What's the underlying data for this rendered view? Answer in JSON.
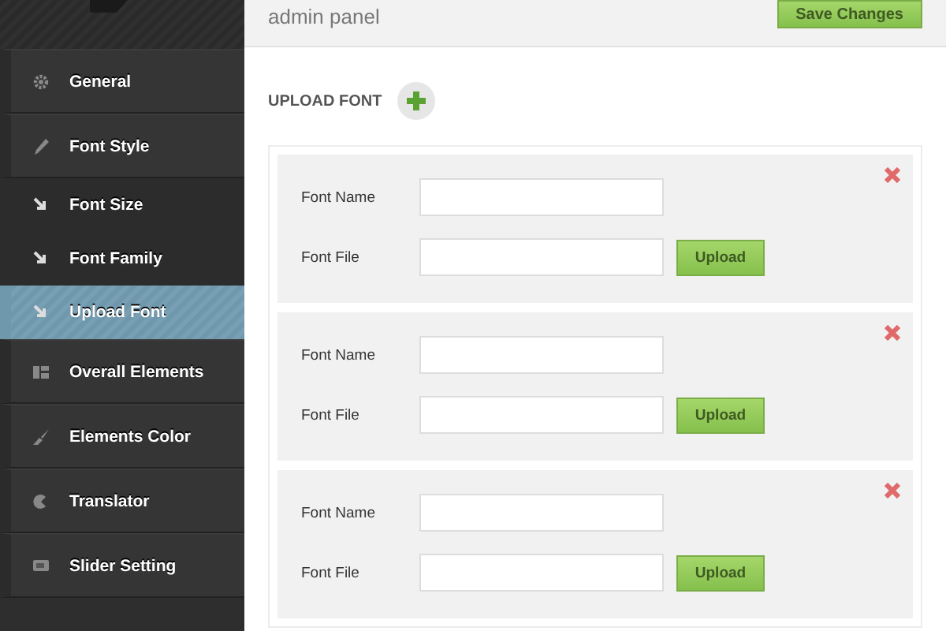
{
  "header": {
    "title": "admin panel",
    "save_button": "Save Changes"
  },
  "sidebar": {
    "items": [
      {
        "label": "General",
        "selected": false
      },
      {
        "label": "Font Style",
        "selected": false,
        "children": [
          {
            "label": "Font Size",
            "selected": false
          },
          {
            "label": "Font Family",
            "selected": false
          },
          {
            "label": "Upload Font",
            "selected": true
          }
        ]
      },
      {
        "label": "Overall Elements",
        "selected": false
      },
      {
        "label": "Elements Color",
        "selected": false
      },
      {
        "label": "Translator",
        "selected": false
      },
      {
        "label": "Slider Setting",
        "selected": false
      }
    ]
  },
  "section": {
    "title": "UPLOAD FONT",
    "entries": [
      {
        "name_label": "Font Name",
        "file_label": "Font File",
        "upload_button": "Upload"
      },
      {
        "name_label": "Font Name",
        "file_label": "Font File",
        "upload_button": "Upload"
      },
      {
        "name_label": "Font Name",
        "file_label": "Font File",
        "upload_button": "Upload"
      }
    ]
  }
}
